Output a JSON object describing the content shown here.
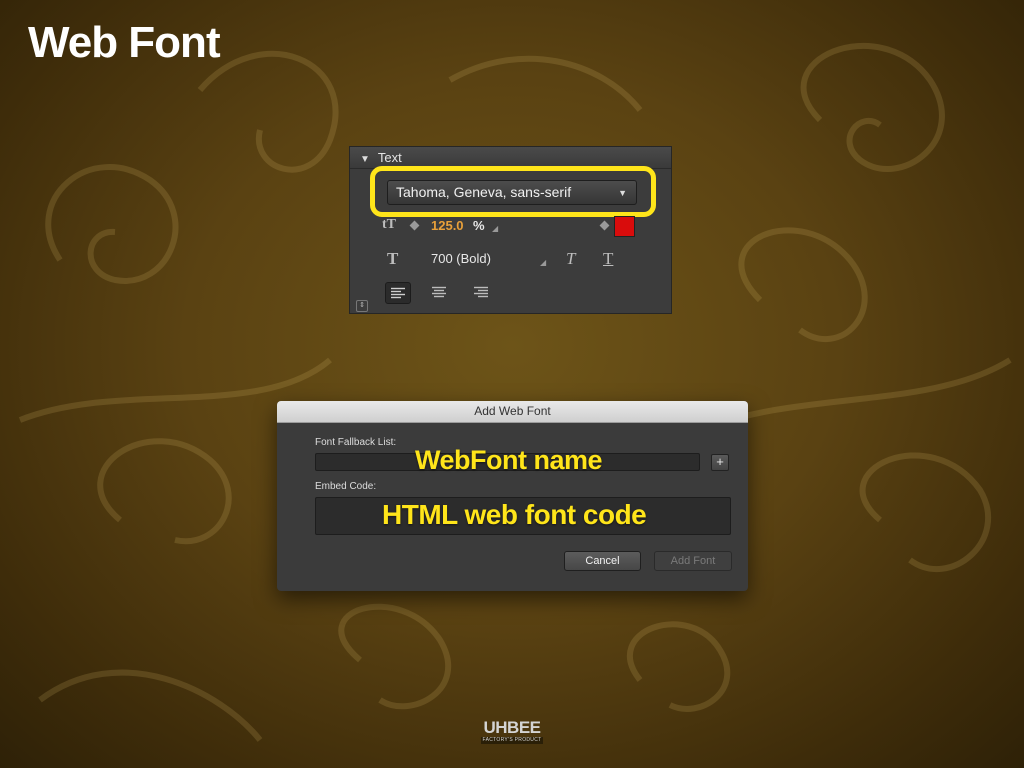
{
  "slide": {
    "title": "Web Font"
  },
  "text_panel": {
    "header": "Text",
    "font_family": "Tahoma, Geneva, sans-serif",
    "font_size": "125.0",
    "font_size_unit": "%",
    "font_weight": "700 (Bold)",
    "color": "#d90c0c",
    "alignment_selected": "left"
  },
  "dialog": {
    "title": "Add Web Font",
    "fallback_label": "Font Fallback List:",
    "fallback_annotation": "WebFont name",
    "add_fallback": "+",
    "embed_label": "Embed Code:",
    "embed_annotation": "HTML web font code",
    "cancel_label": "Cancel",
    "add_font_label": "Add Font"
  },
  "colors": {
    "highlight": "#ffe51a",
    "annotation": "#ffe51a"
  },
  "logo": {
    "name": "UHBEE",
    "tagline": "FACTORY'S PRODUCT"
  }
}
